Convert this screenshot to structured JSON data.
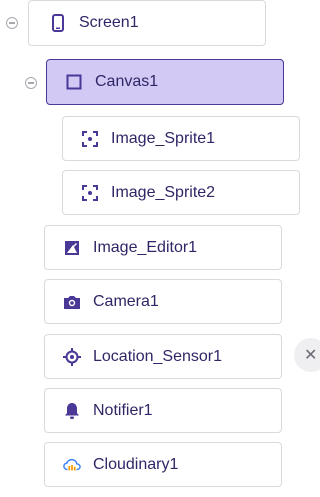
{
  "tree": {
    "screen": {
      "label": "Screen1",
      "icon": "phone-icon"
    },
    "canvas": {
      "label": "Canvas1",
      "icon": "square-icon"
    },
    "sprites": [
      {
        "label": "Image_Sprite1",
        "icon": "sprite-icon"
      },
      {
        "label": "Image_Sprite2",
        "icon": "sprite-icon"
      }
    ],
    "components": [
      {
        "label": "Image_Editor1",
        "icon": "image-edit-icon"
      },
      {
        "label": "Camera1",
        "icon": "camera-icon"
      },
      {
        "label": "Location_Sensor1",
        "icon": "location-icon"
      },
      {
        "label": "Notifier1",
        "icon": "bell-icon"
      },
      {
        "label": "Cloudinary1",
        "icon": "cloud-icon"
      }
    ]
  },
  "colors": {
    "accent": "#4a3796",
    "selected_bg": "#d2c9f5",
    "text": "#2f2666"
  }
}
